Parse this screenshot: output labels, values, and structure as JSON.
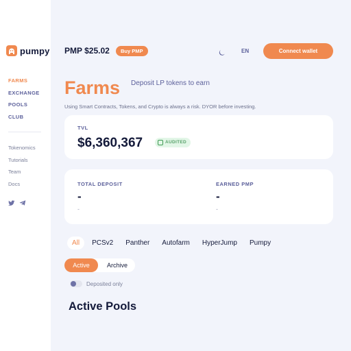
{
  "brand": {
    "name": "pumpy",
    "accent": "#f0894f",
    "text_dark": "#141a3a"
  },
  "nav": {
    "primary": [
      {
        "label": "FARMS",
        "active": true
      },
      {
        "label": "EXCHANGE",
        "active": false
      },
      {
        "label": "POOLS",
        "active": false
      },
      {
        "label": "CLUB",
        "active": false
      }
    ],
    "secondary": [
      {
        "label": "Tokenomics"
      },
      {
        "label": "Tutorials"
      },
      {
        "label": "Team"
      },
      {
        "label": "Docs"
      }
    ],
    "socials": [
      "twitter-icon",
      "telegram-icon"
    ]
  },
  "topbar": {
    "price": "PMP $25.02",
    "buy_label": "Buy PMP",
    "theme_icon": "moon-icon",
    "lang": "EN",
    "connect_label": "Connect wallet"
  },
  "page": {
    "title": "Farms",
    "subtitle": "Deposit LP tokens to earn",
    "disclaimer": "Using Smart Contracts, Tokens, and Crypto is always a risk. DYOR before investing."
  },
  "tvl": {
    "label": "TVL",
    "value": "$6,360,367",
    "badge": "AUDITED"
  },
  "deposit": {
    "total_label": "TOTAL DEPOSIT",
    "total_value": "-",
    "total_sub": "-",
    "earned_label": "EARNED PMP",
    "earned_value": "-",
    "earned_sub": "-"
  },
  "filters": {
    "tabs": [
      {
        "label": "All",
        "active": true
      },
      {
        "label": "PCSv2",
        "active": false
      },
      {
        "label": "Panther",
        "active": false
      },
      {
        "label": "Autofarm",
        "active": false
      },
      {
        "label": "HyperJump",
        "active": false
      },
      {
        "label": "Pumpy",
        "active": false
      }
    ],
    "status_active": "Active",
    "status_archive": "Archive",
    "deposited_only_label": "Deposited only",
    "deposited_only": false
  },
  "pools": {
    "title": "Active Pools"
  }
}
